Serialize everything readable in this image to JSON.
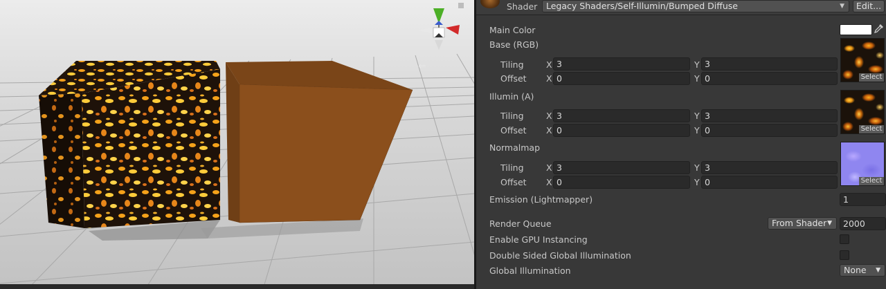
{
  "header": {
    "shader_label": "Shader",
    "shader_value": "Legacy Shaders/Self-Illumin/Bumped Diffuse",
    "edit_label": "Edit..."
  },
  "properties": {
    "main_color_label": "Main Color",
    "main_color_value": "#ffffff",
    "base": {
      "label": "Base (RGB)",
      "tiling_label": "Tiling",
      "offset_label": "Offset",
      "x_label": "X",
      "y_label": "Y",
      "tiling_x": "3",
      "tiling_y": "3",
      "offset_x": "0",
      "offset_y": "0",
      "select_label": "Select"
    },
    "illumin": {
      "label": "Illumin (A)",
      "tiling_label": "Tiling",
      "offset_label": "Offset",
      "x_label": "X",
      "y_label": "Y",
      "tiling_x": "3",
      "tiling_y": "3",
      "offset_x": "0",
      "offset_y": "0",
      "select_label": "Select"
    },
    "normalmap": {
      "label": "Normalmap",
      "tiling_label": "Tiling",
      "offset_label": "Offset",
      "x_label": "X",
      "y_label": "Y",
      "tiling_x": "3",
      "tiling_y": "3",
      "offset_x": "0",
      "offset_y": "0",
      "select_label": "Select"
    },
    "emission_label": "Emission (Lightmapper)",
    "emission_value": "1"
  },
  "advanced": {
    "render_queue_label": "Render Queue",
    "render_queue_mode": "From Shader",
    "render_queue_value": "2000",
    "gpu_instancing_label": "Enable GPU Instancing",
    "gpu_instancing_checked": false,
    "double_sided_gi_label": "Double Sided Global Illumination",
    "double_sided_gi_checked": false,
    "global_illumination_label": "Global Illumination",
    "global_illumination_value": "None"
  },
  "colors": {
    "gizmo_y": "#4caf26",
    "gizmo_x": "#d22a2a",
    "gizmo_z": "#3a5ccc",
    "lava_cube_base": "#1b120a",
    "orange_cube": "#8b4f1c"
  },
  "icons": [
    "material-icon",
    "eyedropper-icon",
    "dropdown-arrow-icon",
    "scene-gizmo-icon"
  ]
}
